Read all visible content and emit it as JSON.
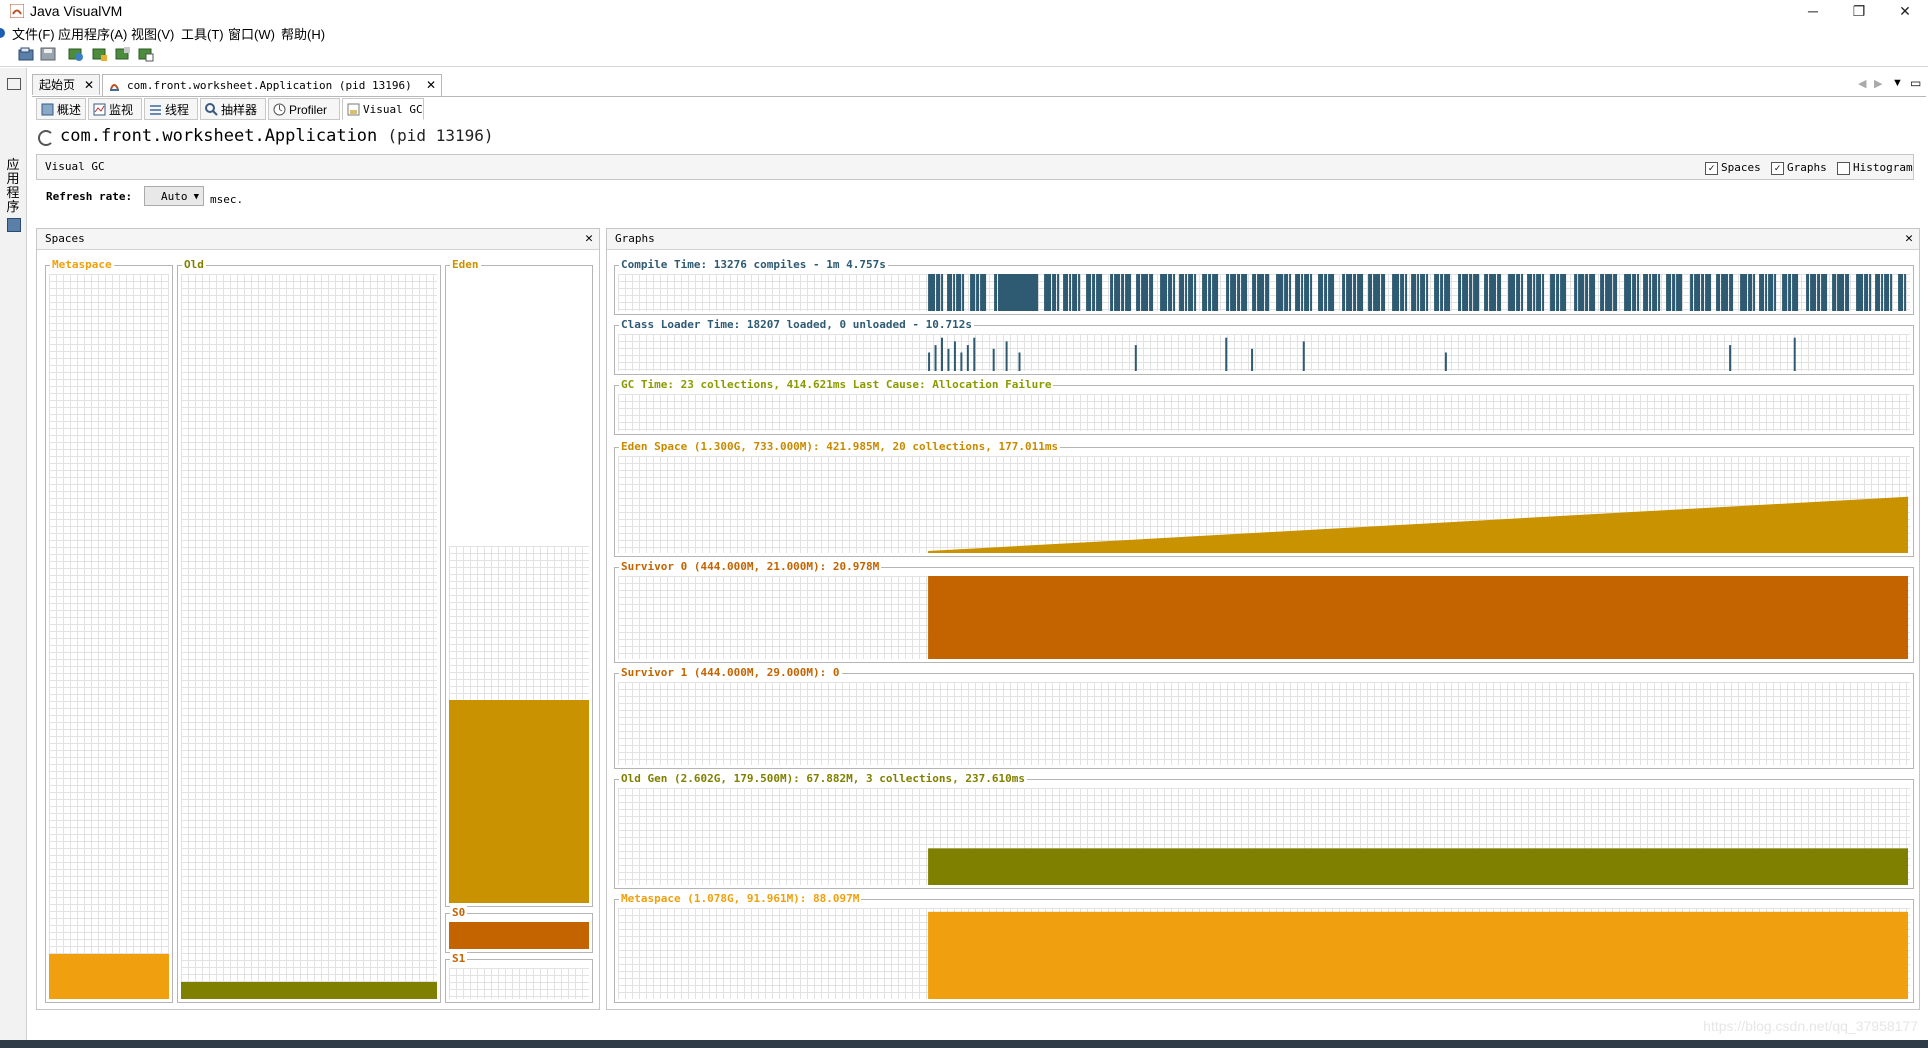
{
  "window": {
    "title": "Java VisualVM",
    "minimize": "─",
    "restore": "❐",
    "close": "✕"
  },
  "menu": [
    "文件(F)",
    "应用程序(A)",
    "视图(V)",
    "工具(T)",
    "窗口(W)",
    "帮助(H)"
  ],
  "left_strip_label": "应用程序",
  "doc_tabs": [
    {
      "label": "起始页",
      "close": "✕"
    },
    {
      "label": "com.front.worksheet.Application (pid 13196)",
      "close": "✕"
    }
  ],
  "sub_tabs": [
    "概述",
    "监视",
    "线程",
    "抽样器",
    "Profiler",
    "Visual GC"
  ],
  "app": {
    "name": "com.front.worksheet.Application",
    "pid": "(pid 13196)"
  },
  "vgc_bar": {
    "label": "Visual GC",
    "checks": [
      {
        "label": "Spaces",
        "checked": true
      },
      {
        "label": "Graphs",
        "checked": true
      },
      {
        "label": "Histogram",
        "checked": false
      }
    ]
  },
  "refresh": {
    "label": "Refresh rate:",
    "value": "Auto",
    "unit": "msec."
  },
  "spaces_panel": {
    "title": "Spaces",
    "close": "✕",
    "metaspace": {
      "label": "Metaspace",
      "level": 0.062
    },
    "old": {
      "label": "Old",
      "level": 0.024
    },
    "eden": {
      "label": "Eden",
      "level": 0.57
    },
    "s0": {
      "label": "S0",
      "level": 1.0
    },
    "s1": {
      "label": "S1",
      "level": 0.0
    }
  },
  "graphs_panel": {
    "title": "Graphs",
    "close": "✕",
    "compile": {
      "label": "Compile Time: 13276 compiles - 1m 4.757s"
    },
    "classloader": {
      "label": "Class Loader Time: 18207 loaded, 0 unloaded - 10.712s"
    },
    "gc": {
      "label": "GC Time: 23 collections, 414.621ms Last Cause: Allocation Failure"
    },
    "eden": {
      "label": "Eden Space (1.300G, 733.000M): 421.985M, 20 collections, 177.011ms",
      "start_level": 0.02,
      "end_level": 0.58
    },
    "s0": {
      "label": "Survivor 0 (444.000M, 21.000M): 20.978M",
      "level": 1.0
    },
    "s1": {
      "label": "Survivor 1 (444.000M, 29.000M): 0",
      "level": 0.0
    },
    "old": {
      "label": "Old Gen (2.602G, 179.500M): 67.882M, 3 collections, 237.610ms",
      "level": 0.378
    },
    "meta": {
      "label": "Metaspace (1.078G, 91.961M): 88.097M",
      "level": 0.958
    }
  },
  "colors": {
    "metaspace": "#f0a00e",
    "old": "#808000",
    "eden": "#c99200",
    "survivor": "#c46400",
    "compile": "#2e5a72",
    "label_orange": "#c88a00",
    "label_green": "#8a9a00"
  },
  "watermark": "https://blog.csdn.net/qq_37958177"
}
